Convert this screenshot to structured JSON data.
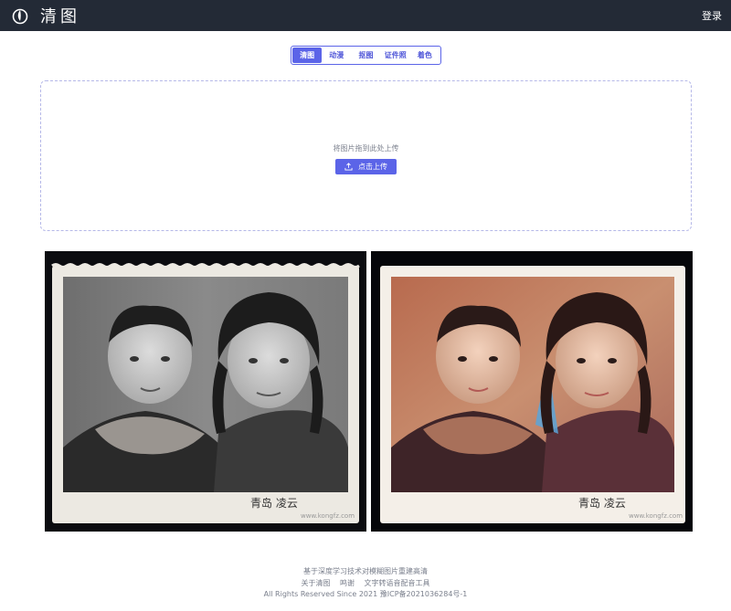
{
  "header": {
    "logo_text": "清图",
    "login_label": "登录"
  },
  "tabs": [
    {
      "label": "清图",
      "active": true
    },
    {
      "label": "动漫",
      "active": false
    },
    {
      "label": "抠图",
      "active": false
    },
    {
      "label": "证件照",
      "active": false
    },
    {
      "label": "着色",
      "active": false
    }
  ],
  "upload": {
    "hint": "将图片拖到此处上传",
    "button_label": "点击上传"
  },
  "photos": {
    "left_stamp": "青岛 凌云",
    "right_stamp": "青岛 凌云",
    "watermark": "www.kongfz.com"
  },
  "footer": {
    "tagline": "基于深度学习技术对模糊图片重建高清",
    "links": [
      "关于清图",
      "鸣谢",
      "文字转语音配音工具"
    ],
    "copyright": "All Rights Reserved Since 2021 豫ICP备2021036284号-1"
  },
  "colors": {
    "header_bg": "#232a36",
    "accent": "#5b64e8"
  }
}
